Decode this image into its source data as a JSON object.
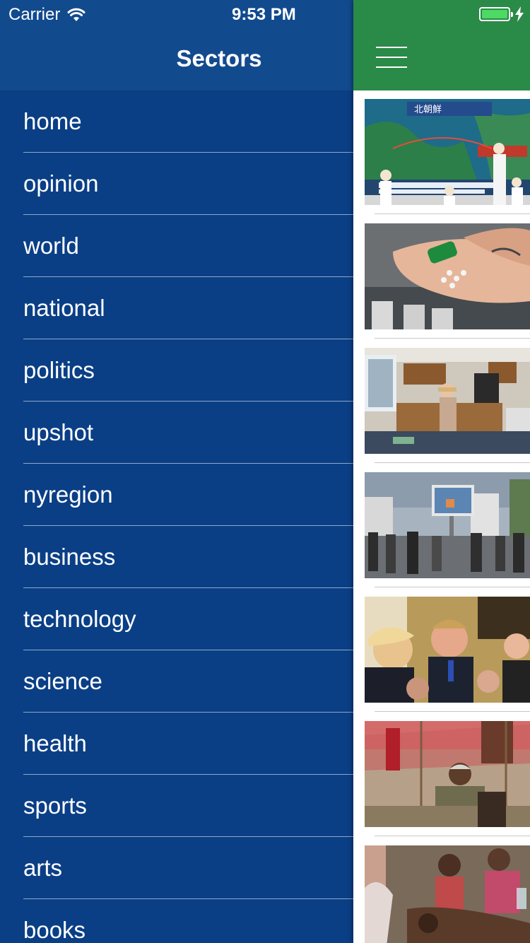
{
  "status_bar": {
    "carrier": "Carrier",
    "time": "9:53 PM",
    "battery_level": 1.0
  },
  "drawer": {
    "title": "Sectors",
    "items": [
      {
        "label": "home"
      },
      {
        "label": "opinion"
      },
      {
        "label": "world"
      },
      {
        "label": "national"
      },
      {
        "label": "politics"
      },
      {
        "label": "upshot"
      },
      {
        "label": "nyregion"
      },
      {
        "label": "business"
      },
      {
        "label": "technology"
      },
      {
        "label": "science"
      },
      {
        "label": "health"
      },
      {
        "label": "sports"
      },
      {
        "label": "arts"
      },
      {
        "label": "books"
      }
    ]
  },
  "main": {
    "nav_icon": "hamburger-menu-icon",
    "feed": [
      {
        "image": "news-broadcast-missile-photo"
      },
      {
        "image": "pills-in-hand-photo"
      },
      {
        "image": "woman-in-kitchen-photo"
      },
      {
        "image": "crowd-watching-screen-photo"
      },
      {
        "image": "men-in-suits-photo"
      },
      {
        "image": "man-under-tent-photo"
      },
      {
        "image": "refugees-group-photo"
      }
    ]
  },
  "colors": {
    "drawer_bg": "#0a3f86",
    "drawer_header_bg": "#124a8e",
    "nav_bar_green": "#2a8a47",
    "battery_green": "#4cd964"
  }
}
